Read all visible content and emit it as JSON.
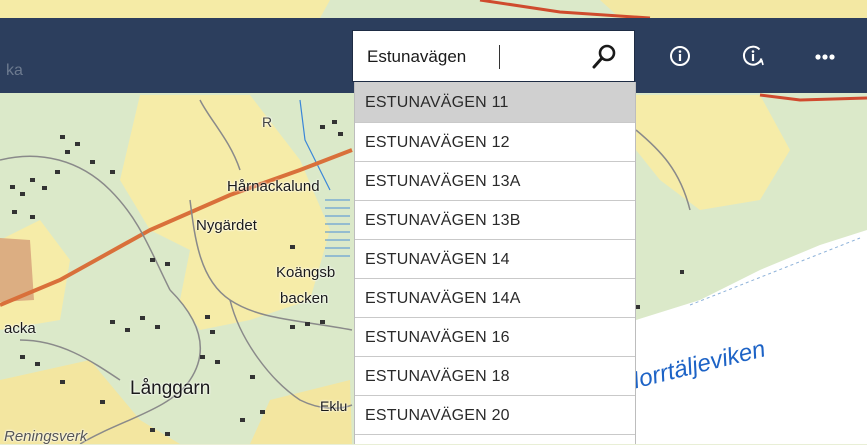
{
  "search": {
    "value": "Estunavägen",
    "results": [
      {
        "label": "ESTUNAVÄGEN 11",
        "active": true
      },
      {
        "label": "ESTUNAVÄGEN 12"
      },
      {
        "label": "ESTUNAVÄGEN 13A"
      },
      {
        "label": "ESTUNAVÄGEN 13B"
      },
      {
        "label": "ESTUNAVÄGEN 14"
      },
      {
        "label": "ESTUNAVÄGEN 14A"
      },
      {
        "label": "ESTUNAVÄGEN 16"
      },
      {
        "label": "ESTUNAVÄGEN 18"
      },
      {
        "label": "ESTUNAVÄGEN 20"
      }
    ]
  },
  "toolbar": {
    "icons": [
      "search-icon",
      "info-icon",
      "info-rotate-icon",
      "more-icon"
    ],
    "background_color": "#2c3e5d"
  },
  "map": {
    "labels": {
      "harnackalund": "Hårnackalund",
      "nygardet": "Nygärdet",
      "koangsb": "Koängsb",
      "backen": "backen",
      "acka": "acka",
      "langgarn": "Långgarn",
      "eklu": "Eklu",
      "norrtaljeviken": "Norrtäljeviken",
      "reningsverk": "Reningsverk",
      "ka": "ka",
      "r": "R"
    },
    "colors": {
      "water": "#ffffff",
      "forest": "#d7e6c3",
      "field": "#f7edab",
      "road": "#d9703a",
      "water_label": "#1d63c6"
    }
  }
}
